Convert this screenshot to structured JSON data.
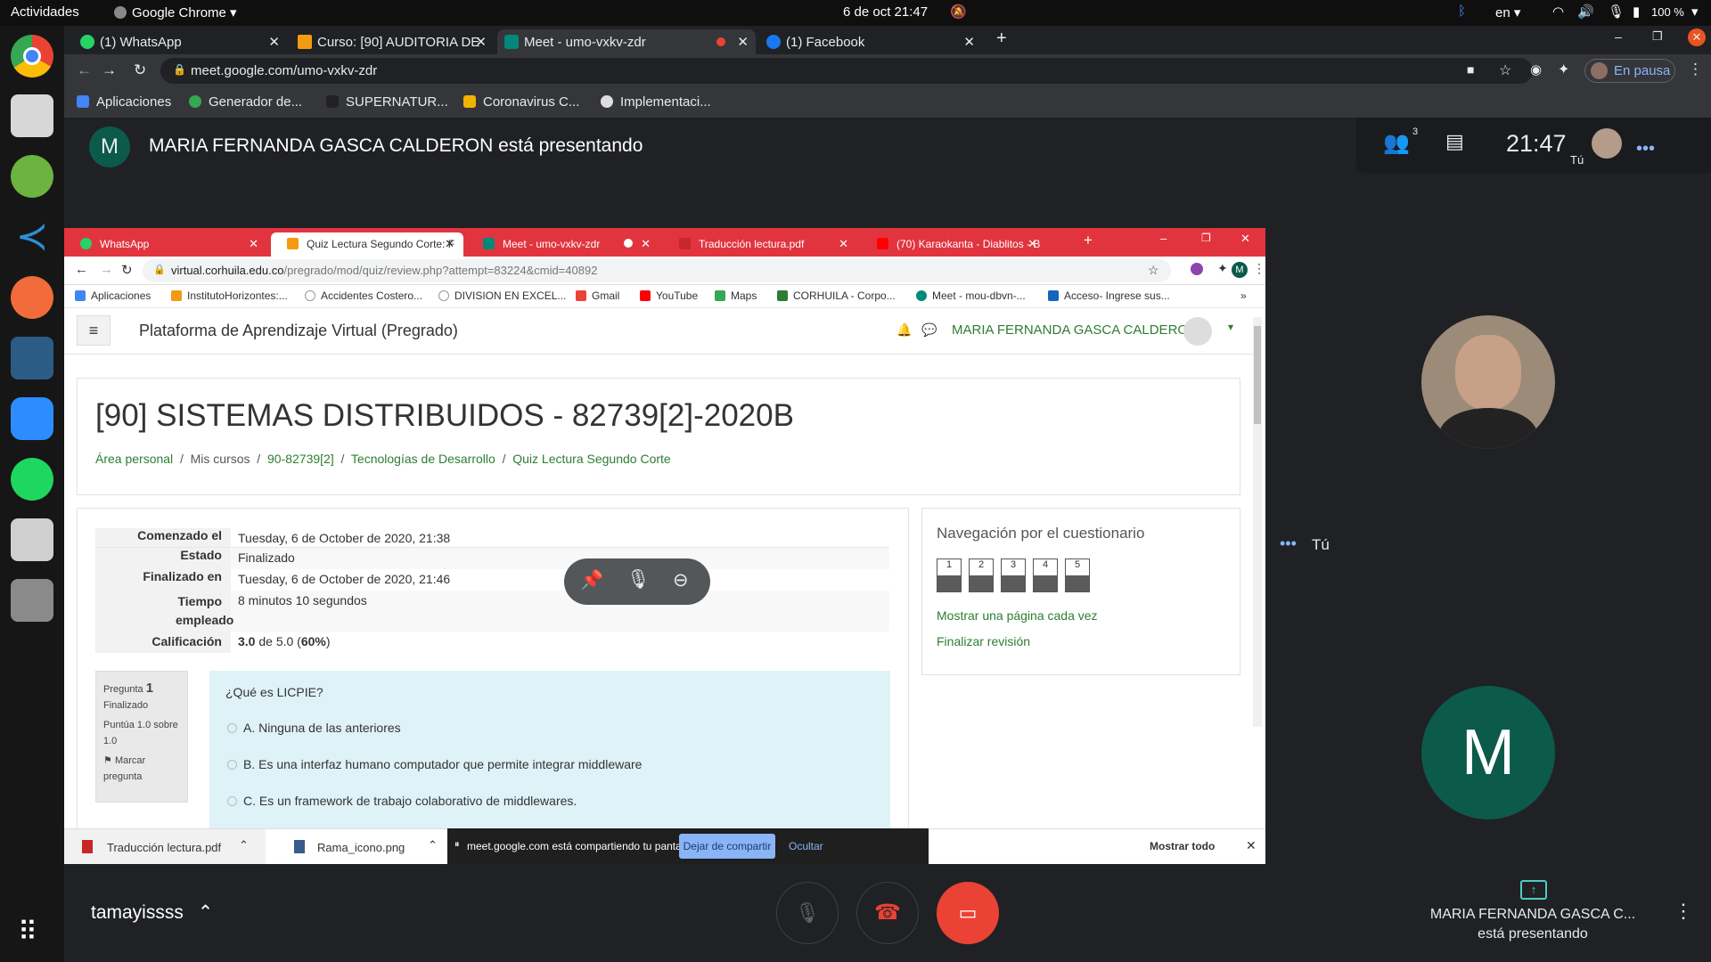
{
  "os_bar": {
    "activities": "Actividades",
    "app": "Google Chrome",
    "datetime": "6 de oct  21:47",
    "lang": "en",
    "battery": "100 %"
  },
  "chrome": {
    "tabs": [
      {
        "label": "(1) WhatsApp"
      },
      {
        "label": "Curso: [90] AUDITORIA DE"
      },
      {
        "label": "Meet - umo-vxkv-zdr"
      },
      {
        "label": "(1) Facebook"
      }
    ],
    "url": "meet.google.com/umo-vxkv-zdr",
    "profile": "En pausa",
    "bookmarks": [
      "Aplicaciones",
      "Generador de...",
      "SUPERNATUR...",
      "Coronavirus C...",
      "Implementaci..."
    ]
  },
  "meet": {
    "presenter_initial": "M",
    "presenting_text": "MARIA FERNANDA GASCA CALDERON está presentando",
    "participants_count": "3",
    "time": "21:47",
    "you_label": "Tú",
    "user_name": "tamayissss",
    "tile_name": "MARIA FERNANDA GASCA C...",
    "tile_status": "está presentando"
  },
  "shared": {
    "tabs": [
      {
        "label": "WhatsApp"
      },
      {
        "label": "Quiz Lectura Segundo Corte: F"
      },
      {
        "label": "Meet - umo-vxkv-zdr"
      },
      {
        "label": "Traducción lectura.pdf"
      },
      {
        "label": "(70) Karaokanta - Diablitos - B"
      }
    ],
    "url_host": "virtual.corhuila.edu.co",
    "url_path": "/pregrado/mod/quiz/review.php?attempt=83224&cmid=40892",
    "avatar_initial": "M",
    "bookmarks": [
      "Aplicaciones",
      "InstitutoHorizontes:...",
      "Accidentes Costero...",
      "DIVISION EN EXCEL...",
      "Gmail",
      "YouTube",
      "Maps",
      "CORHUILA - Corpo...",
      "Meet - mou-dbvn-...",
      "Acceso- Ingrese sus..."
    ],
    "platform_title": "Plataforma de Aprendizaje Virtual (Pregrado)",
    "user": "MARIA FERNANDA GASCA CALDERON",
    "course_title": "[90] SISTEMAS DISTRIBUIDOS - 82739[2]-2020B",
    "breadcrumb": [
      "Área personal",
      "Mis cursos",
      "90-82739[2]",
      "Tecnologías de Desarrollo",
      "Quiz Lectura Segundo Corte"
    ],
    "summary": [
      {
        "k": "Comenzado el",
        "v": "Tuesday, 6 de October de 2020, 21:38"
      },
      {
        "k": "Estado",
        "v": "Finalizado"
      },
      {
        "k": "Finalizado en",
        "v": "Tuesday, 6 de October de 2020, 21:46"
      },
      {
        "k": "Tiempo empleado",
        "v": "8 minutos 10 segundos"
      }
    ],
    "grade_label": "Calificación",
    "grade_score": "3.0",
    "grade_mid": " de 5.0 (",
    "grade_pct": "60%",
    "grade_end": ")",
    "question": {
      "label": "Pregunta",
      "num": "1",
      "state": "Finalizado",
      "points": "Puntúa 1.0 sobre 1.0",
      "flag": "Marcar pregunta",
      "text": "¿Qué es LICPIE?",
      "options": [
        "A. Ninguna de las anteriores",
        "B. Es una interfaz humano computador que permite integrar middleware",
        "C. Es un framework de trabajo colaborativo de middlewares."
      ]
    },
    "nav": {
      "title": "Navegación por el cuestionario",
      "buttons": [
        "1",
        "2",
        "3",
        "4",
        "5"
      ],
      "link1": "Mostrar una página cada vez",
      "link2": "Finalizar revisión"
    },
    "downloads": [
      "Traducción lectura.pdf",
      "Rama_icono.png"
    ],
    "sharebar": {
      "text": "meet.google.com está compartiendo tu pantalla.",
      "stop": "Dejar de compartir",
      "hide": "Ocultar",
      "show_all": "Mostrar todo"
    }
  },
  "colors": {
    "meet_bg": "#202124",
    "inner_tabbar": "#e2343f",
    "moodle_green": "#2e7d32",
    "avatar_teal": "#0b5a4a",
    "end_call": "#ea4335"
  }
}
